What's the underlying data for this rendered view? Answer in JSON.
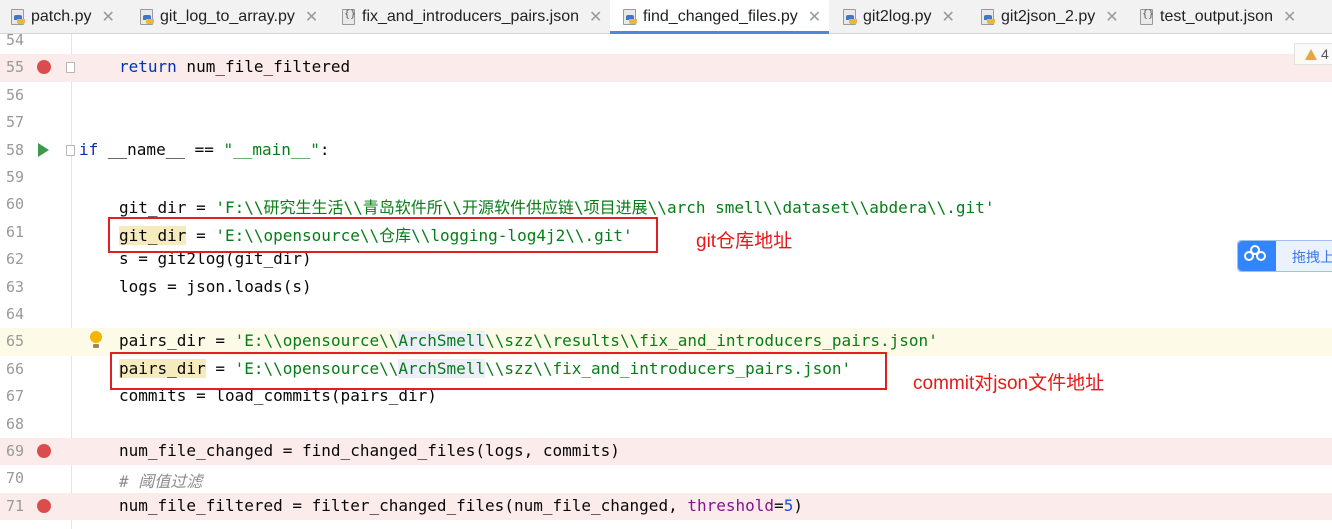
{
  "tabs": [
    {
      "label": "patch.py",
      "kind": "py"
    },
    {
      "label": "git_log_to_array.py",
      "kind": "py"
    },
    {
      "label": "fix_and_introducers_pairs.json",
      "kind": "json"
    },
    {
      "label": "find_changed_files.py",
      "kind": "py",
      "active": true
    },
    {
      "label": "git2log.py",
      "kind": "py"
    },
    {
      "label": "git2json_2.py",
      "kind": "py"
    },
    {
      "label": "test_output.json",
      "kind": "json"
    }
  ],
  "tab_close_glyph": "✕",
  "editor": {
    "line_numbers": [
      "54",
      "55",
      "56",
      "57",
      "58",
      "59",
      "60",
      "61",
      "62",
      "63",
      "64",
      "65",
      "66",
      "67",
      "68",
      "69",
      "70",
      "71"
    ],
    "code": {
      "l55_kw": "return",
      "l55_rest": " num_file_filtered",
      "l58_kw": "if",
      "l58_mid": " __name__ == ",
      "l58_str": "\"__main__\"",
      "l58_end": ":",
      "l60_var": "git_dir",
      "l60_eq": " = ",
      "l60_str": "'F:\\\\研究生生活\\\\青岛软件所\\\\开源软件供应链\\项目进展\\\\arch smell\\\\dataset\\\\abdera\\\\.git'",
      "l61_var": "git_dir",
      "l61_eq": " = ",
      "l61_str": "'E:\\\\opensource\\\\仓库\\\\logging-log4j2\\\\.git'",
      "l62": "s = git2log(git_dir)",
      "l63": "logs = json.loads(s)",
      "l65_var": "pairs_dir",
      "l65_eq": " = ",
      "l65_str_a": "'E:\\\\opensource\\\\",
      "l65_str_b": "ArchSmell",
      "l65_str_c": "\\\\szz\\\\results\\\\fix_and_introducers_pairs.json'",
      "l66_var": "pairs_dir",
      "l66_eq": " = ",
      "l66_str_a": "'E:\\\\opensource\\\\",
      "l66_str_b": "ArchSmell",
      "l66_str_c": "\\\\szz\\\\fix_and_introducers_pairs.json'",
      "l67": "commits = load_commits(pairs_dir)",
      "l69": "num_file_changed = find_changed_files(logs, commits)",
      "l70_cmt": "# 阈值过滤",
      "l71_a": "num_file_filtered = filter_changed_files(num_file_changed, ",
      "l71_param": "threshold",
      "l71_eq": "=",
      "l71_num": "5",
      "l71_end": ")"
    }
  },
  "annotations": {
    "git_repo": "git仓库地址",
    "commit_json": "commit对json文件地址"
  },
  "warning_count": "4",
  "side_panel_label": "拖拽上",
  "colors": {
    "keyword": "#0033b3",
    "string": "#067d17",
    "annotation_red": "#e02020",
    "breakpoint": "#db4c4c",
    "active_tab_underline": "#4a88d8"
  }
}
